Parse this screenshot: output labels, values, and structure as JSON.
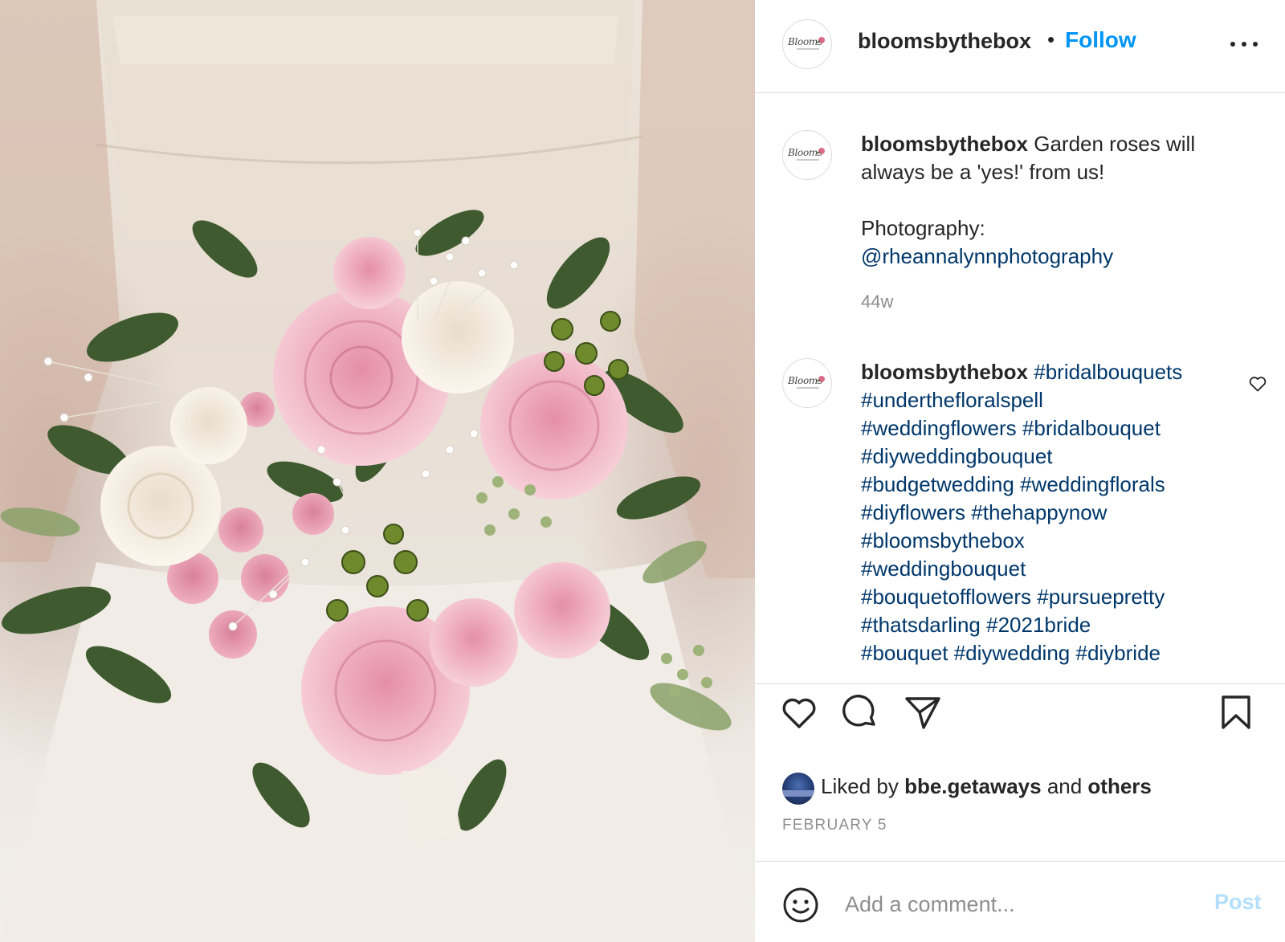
{
  "post": {
    "author": "bloomsbythebox",
    "follow_label": "Follow",
    "separator": "•",
    "avatar_logo": "Blooms"
  },
  "caption": {
    "user": "bloomsbythebox",
    "text_line1": " Garden roses will",
    "text_line2": "always be a 'yes!' from us!",
    "photo_label": "Photography:",
    "photo_credit": "@rheannalynnphotography",
    "time": "44w"
  },
  "hashtag_comment": {
    "user": "bloomsbythebox",
    "tags": [
      "#bridalbouquets",
      "#underthefloralspell",
      "#weddingflowers",
      "#bridalbouquet",
      "#diyweddingbouquet",
      "#budgetwedding",
      "#weddingflorals",
      "#diyflowers",
      "#thehappynow",
      "#bloomsbythebox",
      "#weddingbouquet",
      "#bouquetofflowers",
      "#pursuepretty",
      "#thatsdarling",
      "#2021bride",
      "#bouquet",
      "#diywedding",
      "#diybride"
    ]
  },
  "likes": {
    "prefix": "Liked by ",
    "user": "bbe.getaways",
    "middle": " and ",
    "others": "others"
  },
  "date": "FEBRUARY 5",
  "comment_box": {
    "placeholder": "Add a comment...",
    "post_label": "Post"
  },
  "icons": {
    "more": "more-options-icon",
    "like": "heart-icon",
    "comment": "comment-bubble-icon",
    "share": "paper-plane-icon",
    "save": "bookmark-icon",
    "emoji": "smiley-icon"
  },
  "colors": {
    "link": "#00376b",
    "follow": "#0095f6",
    "post_disabled": "#b2dffc",
    "muted": "#8e8e8e"
  }
}
